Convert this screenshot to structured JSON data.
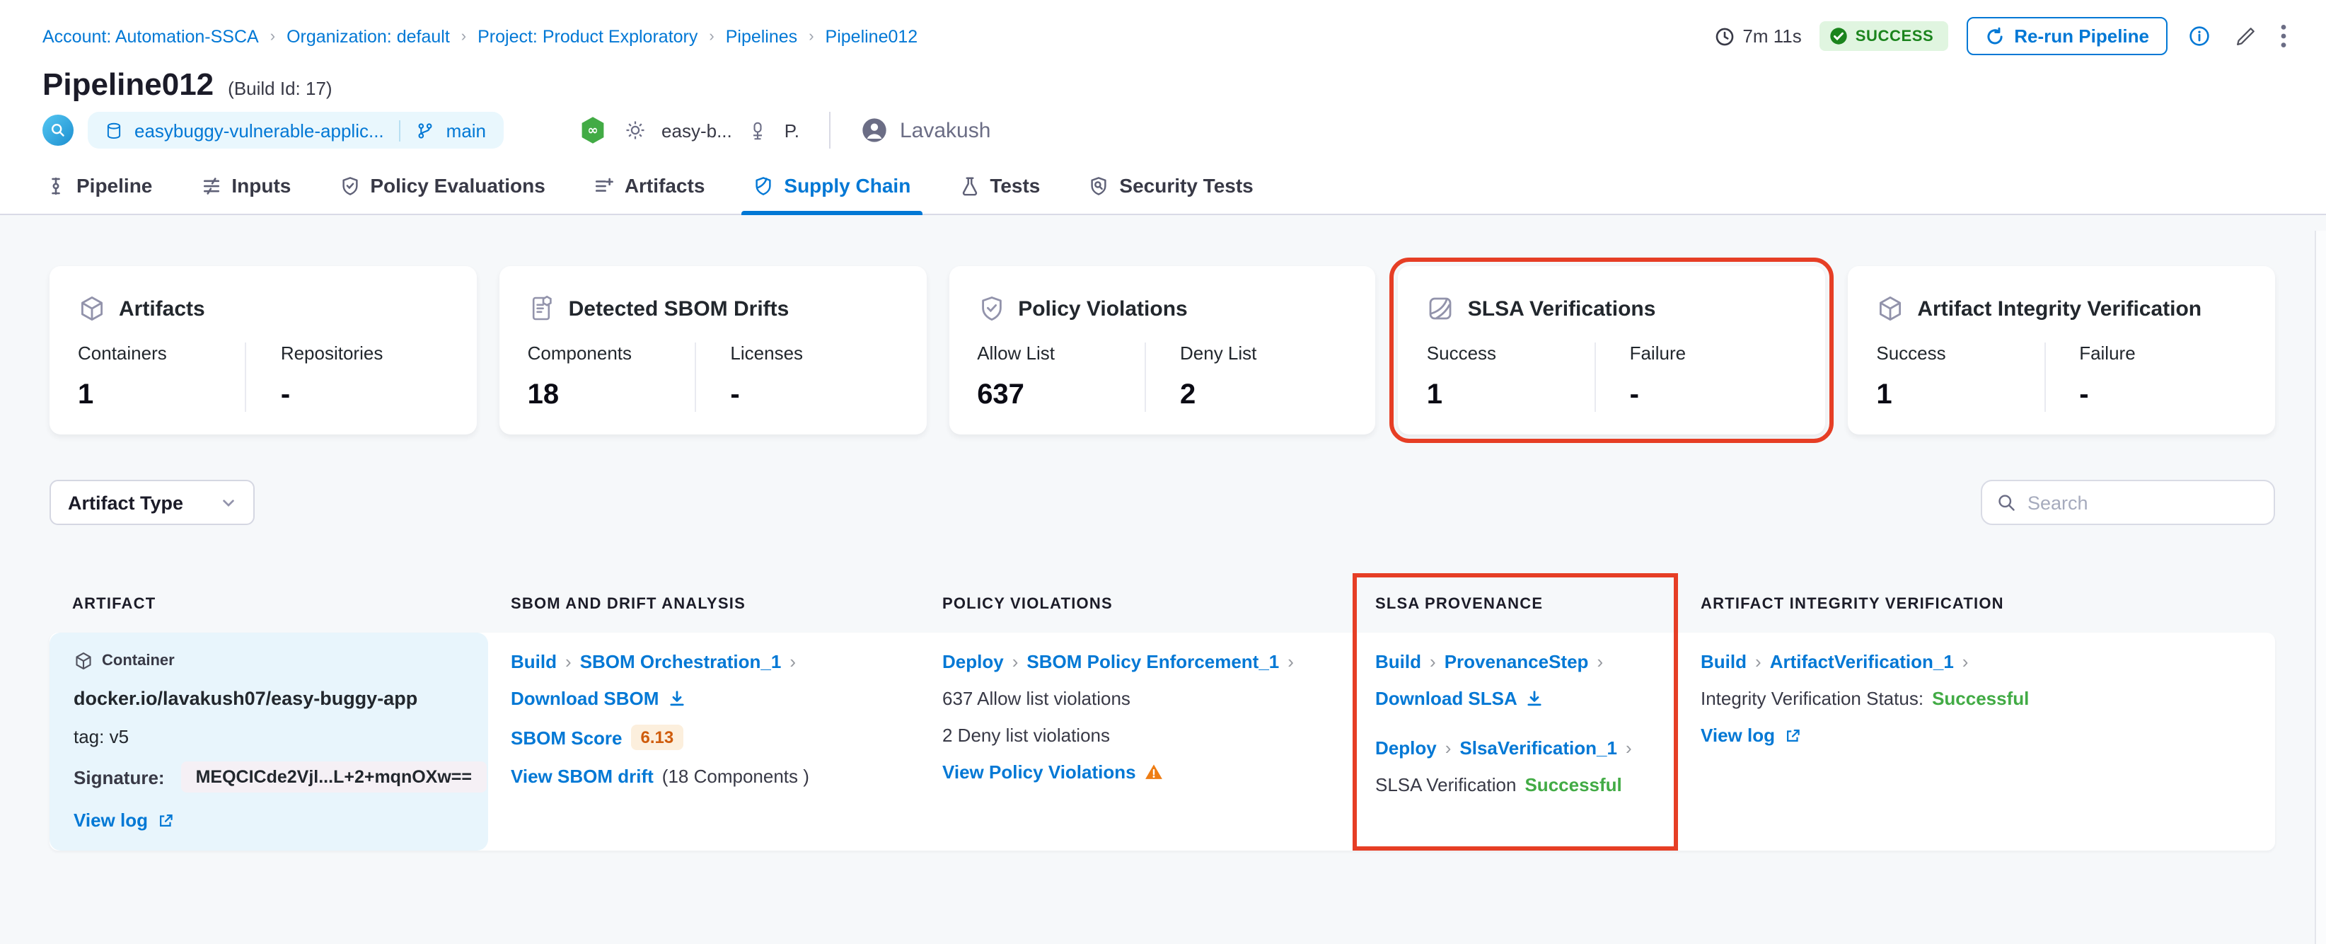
{
  "glyphs": {
    "chevron": "›"
  },
  "breadcrumb": {
    "separator": "›",
    "items": [
      "Account: Automation-SSCA",
      "Organization: default",
      "Project: Product Exploratory",
      "Pipelines",
      "Pipeline012"
    ]
  },
  "header": {
    "title": "Pipeline012",
    "build_id": "(Build Id: 17)",
    "duration": "7m 11s",
    "status_badge": "SUCCESS",
    "rerun_label": "Re-run Pipeline",
    "repo_name": "easybuggy-vulnerable-applic...",
    "branch": "main",
    "service_name": "easy-b...",
    "env_name": "P.",
    "user_name": "Lavakush"
  },
  "tabs": [
    {
      "label": "Pipeline"
    },
    {
      "label": "Inputs"
    },
    {
      "label": "Policy Evaluations"
    },
    {
      "label": "Artifacts"
    },
    {
      "label": "Supply Chain",
      "active": true
    },
    {
      "label": "Tests"
    },
    {
      "label": "Security Tests"
    }
  ],
  "cards": [
    {
      "title": "Artifacts",
      "stats": [
        {
          "label": "Containers",
          "value": "1"
        },
        {
          "label": "Repositories",
          "value": "-"
        }
      ]
    },
    {
      "title": "Detected SBOM Drifts",
      "stats": [
        {
          "label": "Components",
          "value": "18"
        },
        {
          "label": "Licenses",
          "value": "-"
        }
      ]
    },
    {
      "title": "Policy Violations",
      "stats": [
        {
          "label": "Allow List",
          "value": "637"
        },
        {
          "label": "Deny List",
          "value": "2"
        }
      ]
    },
    {
      "title": "SLSA Verifications",
      "highlighted": true,
      "stats": [
        {
          "label": "Success",
          "value": "1"
        },
        {
          "label": "Failure",
          "value": "-"
        }
      ]
    },
    {
      "title": "Artifact Integrity Verification",
      "stats": [
        {
          "label": "Success",
          "value": "1"
        },
        {
          "label": "Failure",
          "value": "-"
        }
      ]
    }
  ],
  "filters": {
    "artifact_type_label": "Artifact Type",
    "search_placeholder": "Search"
  },
  "table": {
    "columns": [
      "ARTIFACT",
      "SBOM AND DRIFT ANALYSIS",
      "POLICY VIOLATIONS",
      "SLSA PROVENANCE",
      "ARTIFACT INTEGRITY VERIFICATION"
    ],
    "row": {
      "artifact": {
        "type_label": "Container",
        "image": "docker.io/lavakush07/easy-buggy-app",
        "tag": "tag: v5",
        "signature_label": "Signature:",
        "signature_value": "MEQCICde2Vjl...L+2+mqnOXw==",
        "view_log_label": "View log"
      },
      "sbom": {
        "stage": "Build",
        "step": "SBOM Orchestration_1",
        "download_label": "Download SBOM",
        "score_label": "SBOM Score",
        "score_value": "6.13",
        "drift_link": "View SBOM drift",
        "drift_detail": "(18 Components )"
      },
      "policy": {
        "stage": "Deploy",
        "step": "SBOM Policy Enforcement_1",
        "allow_text": "637 Allow list violations",
        "deny_text": "2 Deny list violations",
        "link": "View Policy Violations"
      },
      "slsa": {
        "stage1": "Build",
        "step1": "ProvenanceStep",
        "download_label": "Download SLSA",
        "stage2": "Deploy",
        "step2": "SlsaVerification_1",
        "status_label": "SLSA Verification",
        "status_value": "Successful"
      },
      "integrity": {
        "stage": "Build",
        "step": "ArtifactVerification_1",
        "status_label": "Integrity Verification Status:",
        "status_value": "Successful",
        "view_log_label": "View log"
      }
    }
  },
  "colors": {
    "accent_blue": "#0278d5",
    "success_green": "#42ab45",
    "highlight_red": "#e63e25",
    "warning_orange": "#ee7d14",
    "badge_green_bg": "#e0f5e0",
    "badge_green_text": "#1b841d"
  }
}
